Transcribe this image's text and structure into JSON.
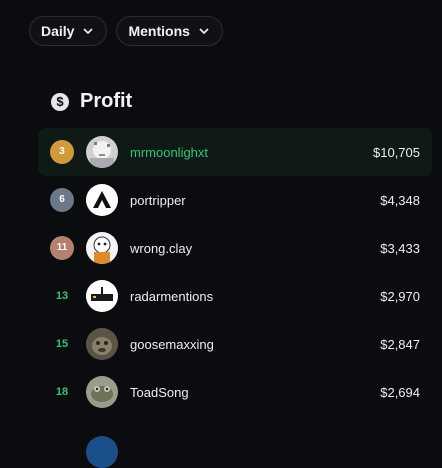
{
  "filters": {
    "period_label": "Daily",
    "type_label": "Mentions"
  },
  "section": {
    "icon": "dollar-circle-icon",
    "title": "Profit"
  },
  "leaderboard": [
    {
      "rank": "3",
      "rank_color": "#d19a3a",
      "name": "mrmoonlighxt",
      "amount": "$10,705",
      "highlight": true
    },
    {
      "rank": "6",
      "rank_color": "#6b7888",
      "name": "portripper",
      "amount": "$4,348"
    },
    {
      "rank": "11",
      "rank_color": "#b5806f",
      "name": "wrong.clay",
      "amount": "$3,433"
    },
    {
      "rank": "13",
      "name": "radarmentions",
      "amount": "$2,970"
    },
    {
      "rank": "15",
      "name": "goosemaxxing",
      "amount": "$2,847"
    },
    {
      "rank": "18",
      "name": "ToadSong",
      "amount": "$2,694"
    }
  ],
  "colors": {
    "accent_green": "#2fc57b",
    "background": "#0b0c0f",
    "highlight_row": "#0f1a17"
  }
}
